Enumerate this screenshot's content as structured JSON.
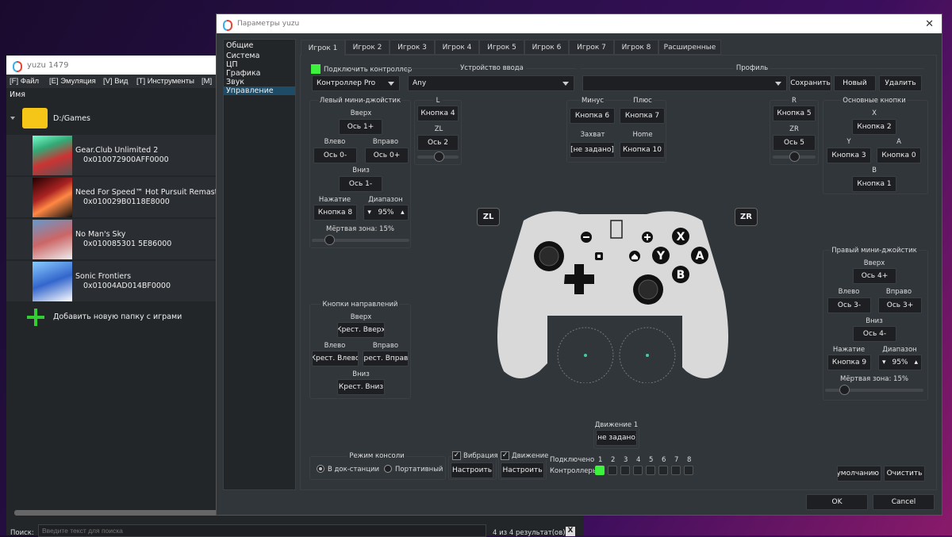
{
  "left_window": {
    "title": "yuzu 1479",
    "menu": [
      "[F] Файл",
      "[E] Эмуляция",
      "[V] Вид",
      "[T] Инструменты",
      "[M]"
    ],
    "column_header": "Имя",
    "folder": "D:/Games",
    "games": [
      {
        "title": "Gear.Club Unlimited 2",
        "id": "0x010072900AFF0000"
      },
      {
        "title": "Need For Speed™ Hot Pursuit Remastered",
        "id": "0x010029B0118E8000"
      },
      {
        "title": "No Man's Sky",
        "id": "0x010085301 5E86000"
      },
      {
        "title": "Sonic Frontiers",
        "id": "0x01004AD014BF0000"
      }
    ],
    "add_folder": "Добавить новую папку с играми",
    "search_label": "Поиск:",
    "search_placeholder": "Введите текст для поиска",
    "result_count": "4 из 4 результат(ов)",
    "clear": "X"
  },
  "dialog": {
    "title": "Параметры yuzu",
    "sidebar": [
      "Общие",
      "Система",
      "ЦП",
      "Графика",
      "Звук",
      "Управление"
    ],
    "sidebar_selected": "Управление",
    "tabs": [
      "Игрок 1",
      "Игрок 2",
      "Игрок 3",
      "Игрок 4",
      "Игрок 5",
      "Игрок 6",
      "Игрок 7",
      "Игрок 8",
      "Расширенные"
    ],
    "active_tab": "Игрок 1",
    "connect_label": "Подключить контроллер",
    "connect_checked": true,
    "controller_type": "Контроллер Pro",
    "input_device_label": "Устройство ввода",
    "input_device": "Any",
    "profile_label": "Профиль",
    "profile_value": "",
    "save": "Сохранить",
    "new": "Новый",
    "delete": "Удалить",
    "left_stick": {
      "title": "Левый мини-джойстик",
      "up_l": "Вверх",
      "up": "Ось 1+",
      "left_l": "Влево",
      "left": "Ось 0-",
      "right_l": "Вправо",
      "right": "Ось 0+",
      "down_l": "Вниз",
      "down": "Ось 1-",
      "press_l": "Нажатие",
      "press": "Кнопка 8",
      "range_l": "Диапазон",
      "range": "95%",
      "deadzone": "Мёртвая зона: 15%",
      "deadzone_value": 15
    },
    "l_group": {
      "l": "L",
      "l_btn": "Кнопка 4",
      "zl": "ZL",
      "zl_btn": "Ось 2"
    },
    "minus_plus": {
      "minus_l": "Минус",
      "minus": "Кнопка 6",
      "plus_l": "Плюс",
      "plus": "Кнопка 7",
      "capture_l": "Захват",
      "capture": "[не задано]",
      "home_l": "Home",
      "home": "Кнопка 10"
    },
    "r_group": {
      "r": "R",
      "r_btn": "Кнопка 5",
      "zr": "ZR",
      "zr_btn": "Ось 5"
    },
    "face": {
      "title": "Основные кнопки",
      "x_l": "X",
      "x": "Кнопка 2",
      "y_l": "Y",
      "y": "Кнопка 3",
      "a_l": "A",
      "a": "Кнопка 0",
      "b_l": "B",
      "b": "Кнопка 1"
    },
    "right_stick": {
      "title": "Правый мини-джойстик",
      "up_l": "Вверх",
      "up": "Ось 4+",
      "left_l": "Влево",
      "left": "Ось 3-",
      "right_l": "Вправо",
      "right": "Ось 3+",
      "down_l": "Вниз",
      "down": "Ось 4-",
      "press_l": "Нажатие",
      "press": "Кнопка 9",
      "range_l": "Диапазон",
      "range": "95%",
      "deadzone": "Мёртвая зона: 15%",
      "deadzone_value": 15
    },
    "dpad": {
      "title": "Кнопки направлений",
      "up_l": "Вверх",
      "up": "Крест. Вверх",
      "left_l": "Влево",
      "left": "Крест. Влево",
      "right_l": "Вправо",
      "right": "Крест. Вправо",
      "down_l": "Вниз",
      "down": "Крест. Вниз"
    },
    "zl_badge": "ZL",
    "zr_badge": "ZR",
    "controller_face_labels": {
      "x": "X",
      "y": "Y",
      "a": "A",
      "b": "B"
    },
    "motion": {
      "title": "Движение 1",
      "value": "[не задано]"
    },
    "console_mode": {
      "title": "Режим консоли",
      "docked": "В док-станции",
      "handheld": "Портативный",
      "selected": "В док-станции"
    },
    "vibration": {
      "label": "Вибрация",
      "checked": true,
      "configure": "Настроить"
    },
    "motion_cfg": {
      "label": "Движение",
      "checked": true,
      "configure": "Настроить"
    },
    "connected_label": "Подключено",
    "controllers_label": "Контроллеры",
    "players": [
      "1",
      "2",
      "3",
      "4",
      "5",
      "6",
      "7",
      "8"
    ],
    "connected": [
      true,
      false,
      false,
      false,
      false,
      false,
      false,
      false
    ],
    "defaults": "По умолчанию",
    "clear": "Очистить",
    "ok": "OK",
    "cancel": "Cancel",
    "accent": "#3cf23c"
  }
}
